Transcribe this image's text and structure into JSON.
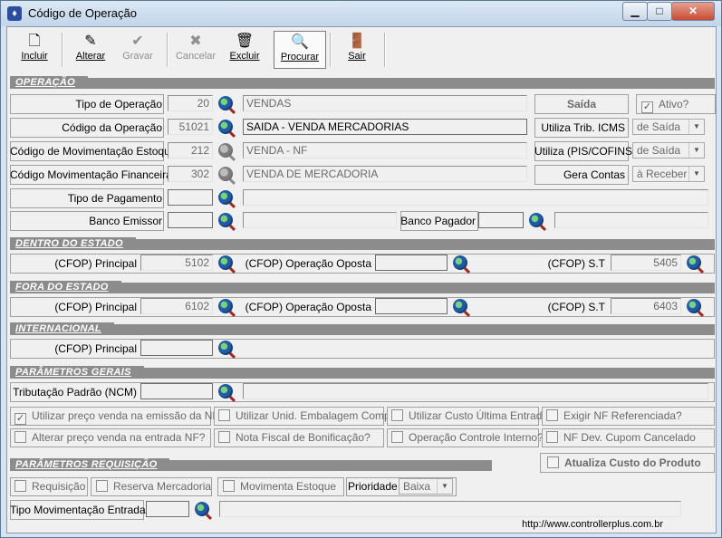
{
  "window": {
    "title": "Código de Operação",
    "minimize": "▁",
    "maximize": "□",
    "close": "✕"
  },
  "toolbar": {
    "incluir": "Incluir",
    "alterar": "Alterar",
    "gravar": "Gravar",
    "cancelar": "Cancelar",
    "excluir": "Excluir",
    "procurar": "Procurar",
    "sair": "Sair"
  },
  "sections": {
    "operacao": "OPERAÇÃO",
    "dentro": "DENTRO DO ESTADO",
    "fora": "FORA DO ESTADO",
    "internacional": "INTERNACIONAL",
    "parametros_gerais": "PARÂMETROS GERAIS",
    "parametros_requisicao": "PARÂMETROS REQUISIÇÃO"
  },
  "operacao": {
    "tipo_operacao": {
      "label": "Tipo de Operação",
      "code": "20",
      "desc": "VENDAS",
      "tag": "Saída",
      "ativo": "Ativo?"
    },
    "codigo_operacao": {
      "label": "Código da Operação",
      "code": "51021",
      "desc": "SAIDA - VENDA MERCADORIAS",
      "trib_label": "Utiliza Trib. ICMS",
      "trib_value": "de Saída"
    },
    "mov_estoque": {
      "label": "Código de Movimentação Estoque",
      "code": "212",
      "desc": "VENDA - NF",
      "pis_label": "Utiliza (PIS/COFINS)",
      "pis_value": "de Saída"
    },
    "mov_financeira": {
      "label": "Código Movimentação Financeira",
      "code": "302",
      "desc": "VENDA DE MERCADORIA",
      "gera_label": "Gera Contas",
      "gera_value": "à Receber"
    },
    "tipo_pagamento": {
      "label": "Tipo de Pagamento",
      "code": "",
      "desc": ""
    },
    "banco_emissor": {
      "label": "Banco Emissor",
      "code": "",
      "desc": ""
    },
    "banco_pagador": {
      "label": "Banco Pagador",
      "code": "",
      "desc": ""
    }
  },
  "dentro": {
    "principal_label": "(CFOP) Principal",
    "principal": "5102",
    "oposta_label": "(CFOP) Operação Oposta",
    "oposta": "",
    "st_label": "(CFOP) S.T",
    "st": "5405"
  },
  "fora": {
    "principal_label": "(CFOP) Principal",
    "principal": "6102",
    "oposta_label": "(CFOP) Operação Oposta",
    "oposta": "",
    "st_label": "(CFOP) S.T",
    "st": "6403"
  },
  "internacional": {
    "principal_label": "(CFOP) Principal",
    "principal": ""
  },
  "parametros_gerais": {
    "ncm_label": "Tributação Padrão (NCM)",
    "ncm": "",
    "checks": [
      {
        "label": "Utilizar preço venda na emissão da NF?",
        "checked": "✓"
      },
      {
        "label": "Utilizar Unid. Embalagem Compra",
        "checked": ""
      },
      {
        "label": "Utilizar Custo Última Entrada",
        "checked": ""
      },
      {
        "label": "Exigir NF Referenciada?",
        "checked": ""
      },
      {
        "label": "Alterar preço venda na entrada NF?",
        "checked": ""
      },
      {
        "label": "Nota Fiscal de Bonificação?",
        "checked": ""
      },
      {
        "label": "Operação Controle Interno?",
        "checked": ""
      },
      {
        "label": "NF Dev. Cupom Cancelado",
        "checked": ""
      }
    ]
  },
  "requisicao": {
    "atualiza_custo": "Atualiza Custo do Produto",
    "requisicao": "Requisição",
    "reserva": "Reserva Mercadoria",
    "movimenta": "Movimenta Estoque",
    "prioridade_label": "Prioridade",
    "prioridade_value": "Baixa",
    "tipo_mov_label": "Tipo Movimentação Entrada",
    "tipo_mov": ""
  },
  "status_url": "http://www.controllerplus.com.br"
}
